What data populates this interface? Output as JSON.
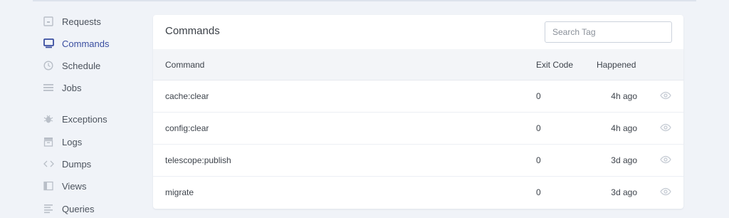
{
  "sidebar": {
    "items": [
      {
        "label": "Requests",
        "icon": "requests-icon"
      },
      {
        "label": "Commands",
        "icon": "commands-icon",
        "active": true
      },
      {
        "label": "Schedule",
        "icon": "clock-icon"
      },
      {
        "label": "Jobs",
        "icon": "jobs-icon"
      },
      {
        "label": "Exceptions",
        "icon": "bug-icon"
      },
      {
        "label": "Logs",
        "icon": "logs-icon"
      },
      {
        "label": "Dumps",
        "icon": "code-icon"
      },
      {
        "label": "Views",
        "icon": "views-icon"
      },
      {
        "label": "Queries",
        "icon": "queries-icon"
      }
    ]
  },
  "panel": {
    "title": "Commands",
    "search_placeholder": "Search Tag",
    "columns": [
      "Command",
      "Exit Code",
      "Happened"
    ],
    "rows": [
      {
        "command": "cache:clear",
        "exit_code": "0",
        "happened": "4h ago"
      },
      {
        "command": "config:clear",
        "exit_code": "0",
        "happened": "4h ago"
      },
      {
        "command": "telescope:publish",
        "exit_code": "0",
        "happened": "3d ago"
      },
      {
        "command": "migrate",
        "exit_code": "0",
        "happened": "3d ago"
      }
    ]
  },
  "colors": {
    "background": "#f0f3f8",
    "accent": "#3a4ea0",
    "icon_muted": "#b9bfc8"
  }
}
